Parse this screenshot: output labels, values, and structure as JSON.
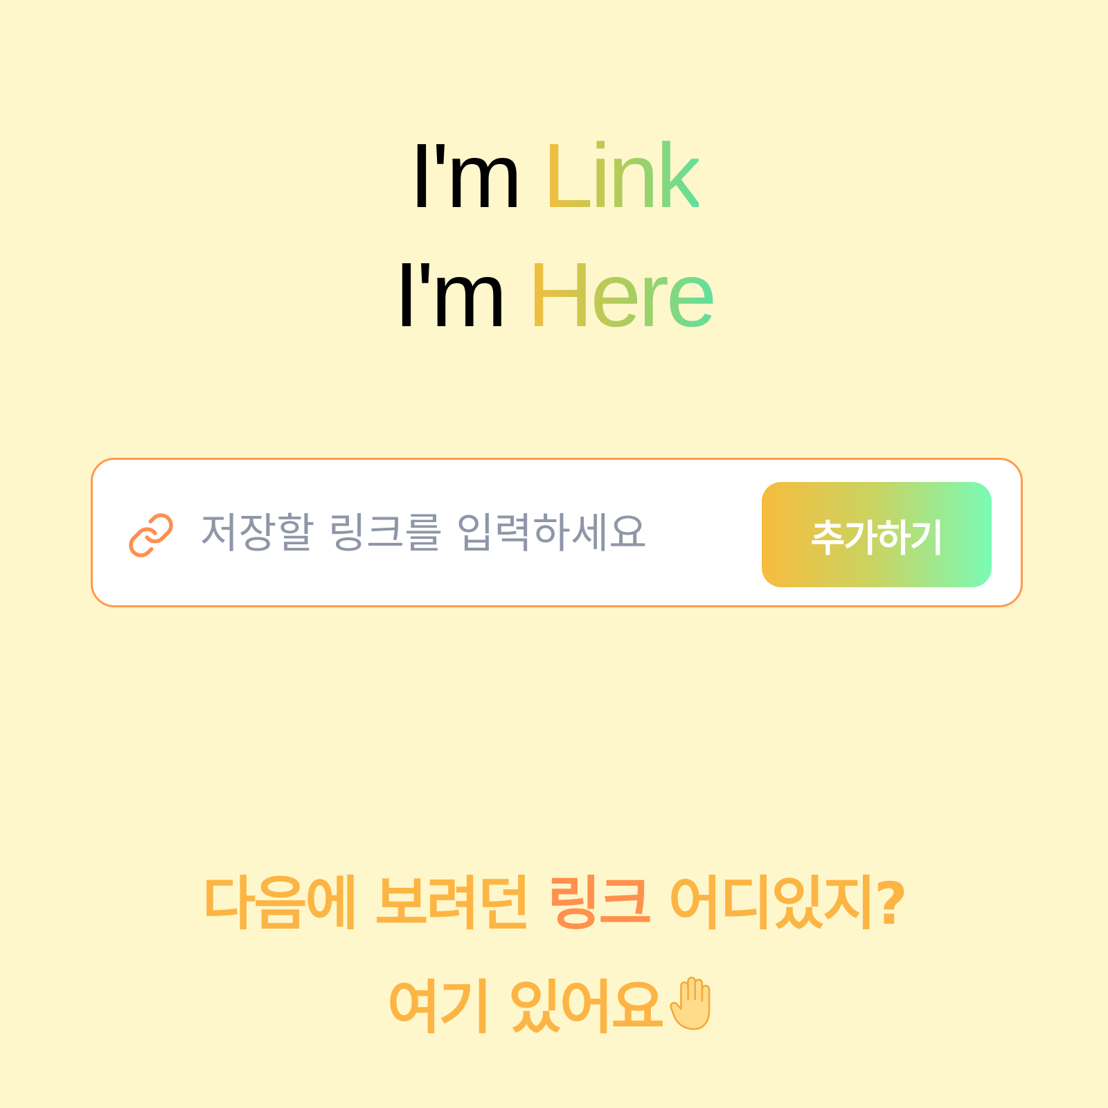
{
  "hero": {
    "line1_prefix": "I'm",
    "line1_highlight": "Link",
    "line2_prefix": "I'm",
    "line2_highlight": "Here"
  },
  "link_bar": {
    "icon": "link-icon",
    "placeholder": "저장할 링크를 입력하세요",
    "value": "",
    "button_label": "추가하기"
  },
  "tagline": {
    "line1_part1": "다음에 보려던",
    "line1_accent": "링크",
    "line1_part2": "어디있지?",
    "line2_text": "여기 있어요",
    "line2_icon": "raised-hand-icon"
  },
  "colors": {
    "background": "#FFF7CC",
    "input_border": "#FF9A4D",
    "tagline": "#FCB544",
    "tagline_accent": "#FF914D",
    "gradient_start": "#F5BD3E",
    "gradient_end": "#5FE09E",
    "button_gradient_end": "#79FBB6"
  }
}
